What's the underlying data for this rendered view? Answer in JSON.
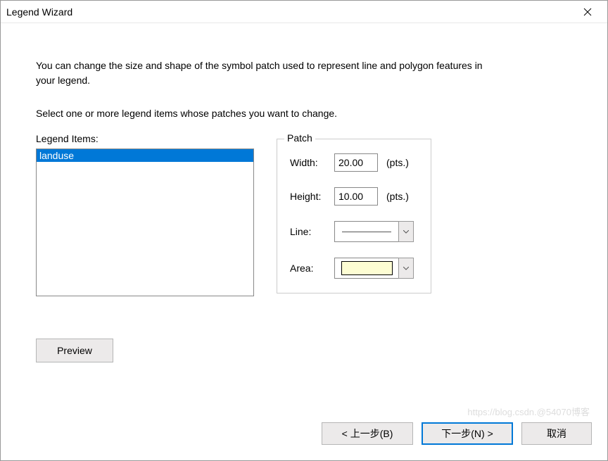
{
  "window": {
    "title": "Legend Wizard"
  },
  "instructions": {
    "line1": "You can change the size and shape of the symbol patch used to represent line and polygon features in your legend.",
    "line2": "Select one or more legend items whose patches you want to change."
  },
  "legend": {
    "label": "Legend Items:",
    "items": [
      "landuse"
    ],
    "selected_index": 0
  },
  "patch": {
    "group_label": "Patch",
    "width_label": "Width:",
    "width_value": "20.00",
    "width_units": "(pts.)",
    "height_label": "Height:",
    "height_value": "10.00",
    "height_units": "(pts.)",
    "line_label": "Line:",
    "area_label": "Area:"
  },
  "buttons": {
    "preview": "Preview",
    "back": "< 上一步(B)",
    "next": "下一步(N) >",
    "cancel": "取消"
  },
  "watermark": "https://blog.csdn.@54070博客"
}
